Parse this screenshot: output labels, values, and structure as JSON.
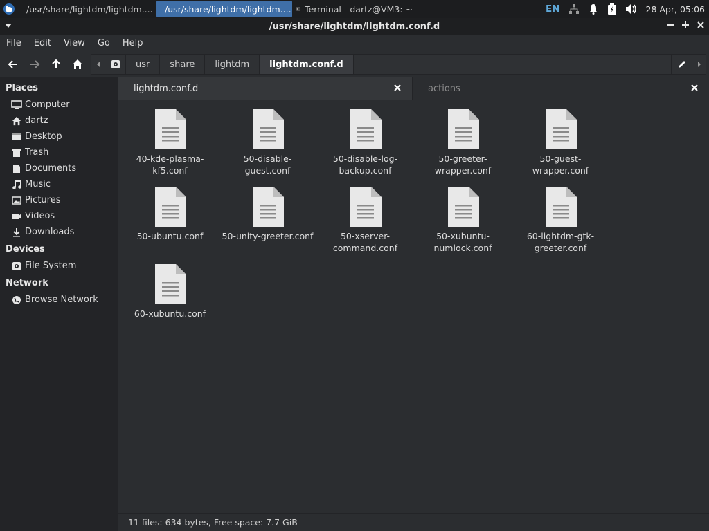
{
  "taskbar": {
    "tasks": [
      {
        "label": "/usr/share/lightdm/lightdm...."
      },
      {
        "label": "/usr/share/lightdm/lightdm...."
      },
      {
        "label": "Terminal - dartz@VM3: ~"
      }
    ],
    "lang": "EN",
    "clock": "28 Apr, 05:06"
  },
  "window": {
    "title": "/usr/share/lightdm/lightdm.conf.d"
  },
  "menubar": {
    "items": [
      {
        "label": "File"
      },
      {
        "label": "Edit"
      },
      {
        "label": "View"
      },
      {
        "label": "Go"
      },
      {
        "label": "Help"
      }
    ]
  },
  "breadcrumbs": {
    "items": [
      {
        "label": "usr"
      },
      {
        "label": "share"
      },
      {
        "label": "lightdm"
      },
      {
        "label": "lightdm.conf.d"
      }
    ]
  },
  "sidebar": {
    "places_header": "Places",
    "places": [
      {
        "label": "Computer",
        "icon": "computer-icon"
      },
      {
        "label": "dartz",
        "icon": "home-icon"
      },
      {
        "label": "Desktop",
        "icon": "desktop-icon"
      },
      {
        "label": "Trash",
        "icon": "trash-icon"
      },
      {
        "label": "Documents",
        "icon": "documents-icon"
      },
      {
        "label": "Music",
        "icon": "music-icon"
      },
      {
        "label": "Pictures",
        "icon": "pictures-icon"
      },
      {
        "label": "Videos",
        "icon": "videos-icon"
      },
      {
        "label": "Downloads",
        "icon": "downloads-icon"
      }
    ],
    "devices_header": "Devices",
    "devices": [
      {
        "label": "File System",
        "icon": "drive-icon"
      }
    ],
    "network_header": "Network",
    "network": [
      {
        "label": "Browse Network",
        "icon": "network-icon"
      }
    ]
  },
  "tabs": [
    {
      "label": "lightdm.conf.d"
    },
    {
      "label": "actions"
    }
  ],
  "files": [
    {
      "name": "40-kde-plasma-kf5.conf"
    },
    {
      "name": "50-disable-guest.conf"
    },
    {
      "name": "50-disable-log-backup.conf"
    },
    {
      "name": "50-greeter-wrapper.conf"
    },
    {
      "name": "50-guest-wrapper.conf"
    },
    {
      "name": "50-ubuntu.conf"
    },
    {
      "name": "50-unity-greeter.conf"
    },
    {
      "name": "50-xserver-command.conf"
    },
    {
      "name": "50-xubuntu-numlock.conf"
    },
    {
      "name": "60-lightdm-gtk-greeter.conf"
    },
    {
      "name": "60-xubuntu.conf"
    }
  ],
  "statusbar": {
    "text": "11 files: 634 bytes, Free space: 7.7 GiB"
  },
  "colors": {
    "accent": "#3f6fa8",
    "background": "#2b2d30",
    "sidebar": "#232427",
    "file_icon": "#e8e8e8"
  }
}
